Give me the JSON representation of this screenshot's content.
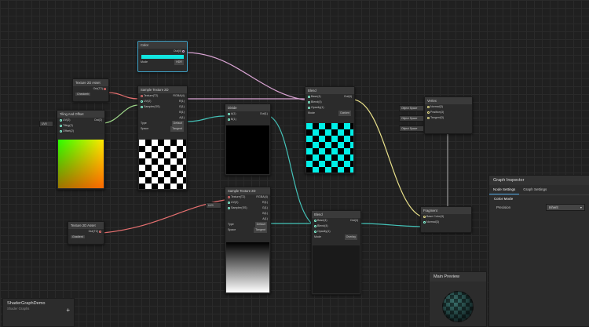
{
  "nodes": {
    "color": {
      "title": "Color",
      "out": "Out(4)",
      "mode_label": "Mode",
      "mode_value": "HDR"
    },
    "texel": {
      "title": "Texture 2D Asset",
      "out": "Out(T2)",
      "value": "Checkerb"
    },
    "tiling": {
      "title": "Tiling And Offset",
      "inputs": [
        "UV(2)",
        "Tiling(2)",
        "Offset(2)"
      ],
      "out": "Out(2)",
      "uv_field": "UV0"
    },
    "sample1": {
      "title": "Sample Texture 2D",
      "inputs": [
        "Texture(T2)",
        "UV(2)",
        "Sampler(SS)"
      ],
      "outputs": [
        "RGBA(4)",
        "R(1)",
        "G(1)",
        "B(1)",
        "A(1)"
      ],
      "type_label": "Type",
      "type_value": "Default",
      "space_label": "Space",
      "space_value": "Tangent"
    },
    "divide": {
      "title": "Divide",
      "inputs": [
        "A(1)",
        "B(1)"
      ],
      "out": "Out(1)"
    },
    "blend": {
      "title": "Blend",
      "inputs": [
        "Base(4)",
        "Blend(4)",
        "Opacity(1)"
      ],
      "out": "Out(4)",
      "mode_label": "Mode",
      "mode_value": "Darken"
    },
    "vertex": {
      "title": "Vertex",
      "inputs": [
        "Object Space",
        "Object Space",
        "Object Space"
      ],
      "labels": [
        "Normal(3)",
        "Position(3)",
        "Tangent(3)"
      ]
    },
    "sample2": {
      "title": "Sample Texture 2D",
      "inputs": [
        "Texture(T2)",
        "UV(2)",
        "Sampler(SS)"
      ],
      "outputs": [
        "RGBA(4)",
        "R(1)",
        "G(1)",
        "B(1)",
        "A(1)"
      ],
      "type_label": "Type",
      "type_value": "Default",
      "space_label": "Space",
      "space_value": "Tangent",
      "uv_field": "UV0"
    },
    "texel2": {
      "title": "Texture 2D Asset",
      "out": "Out(T2)",
      "value": "Gradient"
    },
    "blend2": {
      "title": "Blend",
      "inputs": [
        "Base(4)",
        "Blend(4)",
        "Opacity(1)"
      ],
      "out": "Out(4)",
      "mode_label": "Mode",
      "mode_value": "Overlay"
    },
    "fragment": {
      "title": "Fragment",
      "inputs": [
        "Base Color(3)",
        "Normal(3)"
      ]
    }
  },
  "inspector": {
    "title": "Graph Inspector",
    "tabs": [
      "Node Settings",
      "Graph Settings"
    ],
    "section": "Color Mode",
    "precision_label": "Precision",
    "precision_value": "Inherit"
  },
  "preview": {
    "title": "Main Preview"
  },
  "blackboard": {
    "title": "ShaderGraphDemo",
    "subtitle": "Shader Graphs",
    "add": "+"
  }
}
